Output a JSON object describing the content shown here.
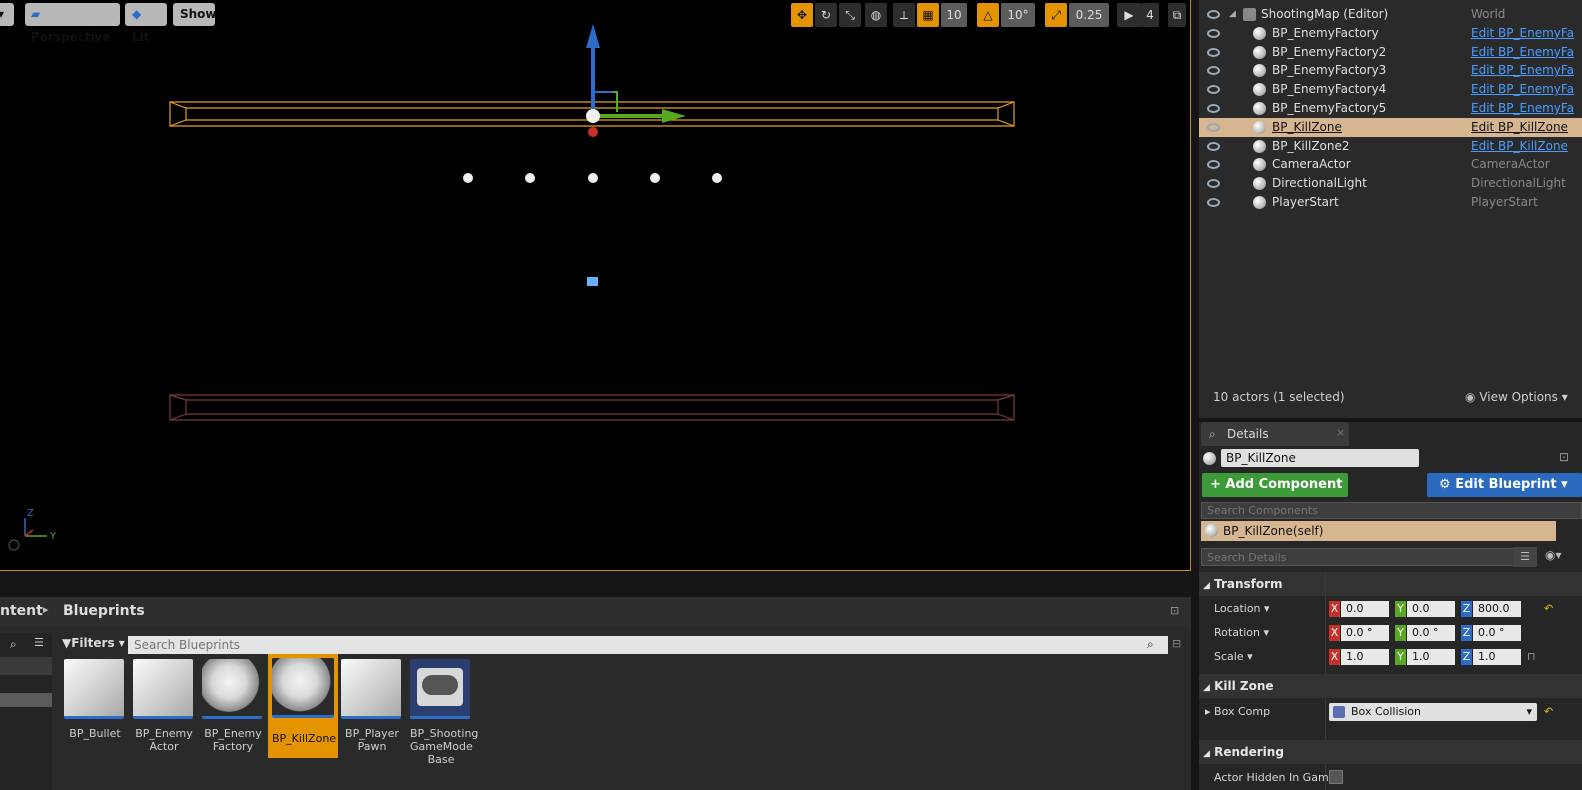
{
  "viewport": {
    "perspective_label": "Perspective",
    "lit_label": "Lit",
    "show_label": "Show",
    "grid_snap": "10",
    "rotation_snap": "10°",
    "scale_snap": "0.25",
    "camera_speed": "4"
  },
  "outliner": {
    "rows": [
      {
        "name": "ShootingMap (Editor)",
        "type": "World",
        "link": false
      },
      {
        "name": "BP_EnemyFactory",
        "type": "Edit BP_EnemyFa",
        "link": true
      },
      {
        "name": "BP_EnemyFactory2",
        "type": "Edit BP_EnemyFa",
        "link": true
      },
      {
        "name": "BP_EnemyFactory3",
        "type": "Edit BP_EnemyFa",
        "link": true
      },
      {
        "name": "BP_EnemyFactory4",
        "type": "Edit BP_EnemyFa",
        "link": true
      },
      {
        "name": "BP_EnemyFactory5",
        "type": "Edit BP_EnemyFa",
        "link": true
      },
      {
        "name": "BP_KillZone",
        "type": "Edit BP_KillZone",
        "link": true,
        "selected": true
      },
      {
        "name": "BP_KillZone2",
        "type": "Edit BP_KillZone",
        "link": true
      },
      {
        "name": "CameraActor",
        "type": "CameraActor",
        "link": false
      },
      {
        "name": "DirectionalLight",
        "type": "DirectionalLight",
        "link": false
      },
      {
        "name": "PlayerStart",
        "type": "PlayerStart",
        "link": false
      }
    ],
    "actor_count": "10 actors (1 selected)",
    "view_options": "View Options"
  },
  "details": {
    "tab_label": "Details",
    "actor_name": "BP_KillZone",
    "add_component": "Add Component",
    "edit_blueprint": "Edit Blueprint",
    "search_components_placeholder": "Search Components",
    "self_component": "BP_KillZone(self)",
    "search_details_placeholder": "Search Details",
    "transform_section": "Transform",
    "location_label": "Location",
    "rotation_label": "Rotation",
    "scale_label": "Scale",
    "location": {
      "x": "0.0",
      "y": "0.0",
      "z": "800.0"
    },
    "rotation": {
      "x": "0.0 °",
      "y": "0.0 °",
      "z": "0.0 °"
    },
    "scale": {
      "x": "1.0",
      "y": "1.0",
      "z": "1.0"
    },
    "kill_zone_section": "Kill Zone",
    "box_comp_label": "Box Comp",
    "box_comp_value": "Box Collision",
    "rendering_section": "Rendering",
    "actor_hidden_label": "Actor Hidden In Game",
    "axis": {
      "x": "X",
      "y": "Y",
      "z": "Z"
    }
  },
  "content_browser": {
    "path_parent": "ntent",
    "path_current": "Blueprints",
    "filters_label": "Filters",
    "search_placeholder": "Search Blueprints",
    "assets": [
      {
        "label": "BP_Bullet"
      },
      {
        "label": "BP_Enemy\nActor"
      },
      {
        "label": "BP_Enemy\nFactory"
      },
      {
        "label": "BP_KillZone",
        "selected": true
      },
      {
        "label": "BP_Player\nPawn"
      },
      {
        "label": "BP_Shooting\nGameMode\nBase"
      }
    ]
  },
  "colors": {
    "accent_orange": "#e39400",
    "selection": "#d6b691",
    "link": "#4a9eff"
  }
}
